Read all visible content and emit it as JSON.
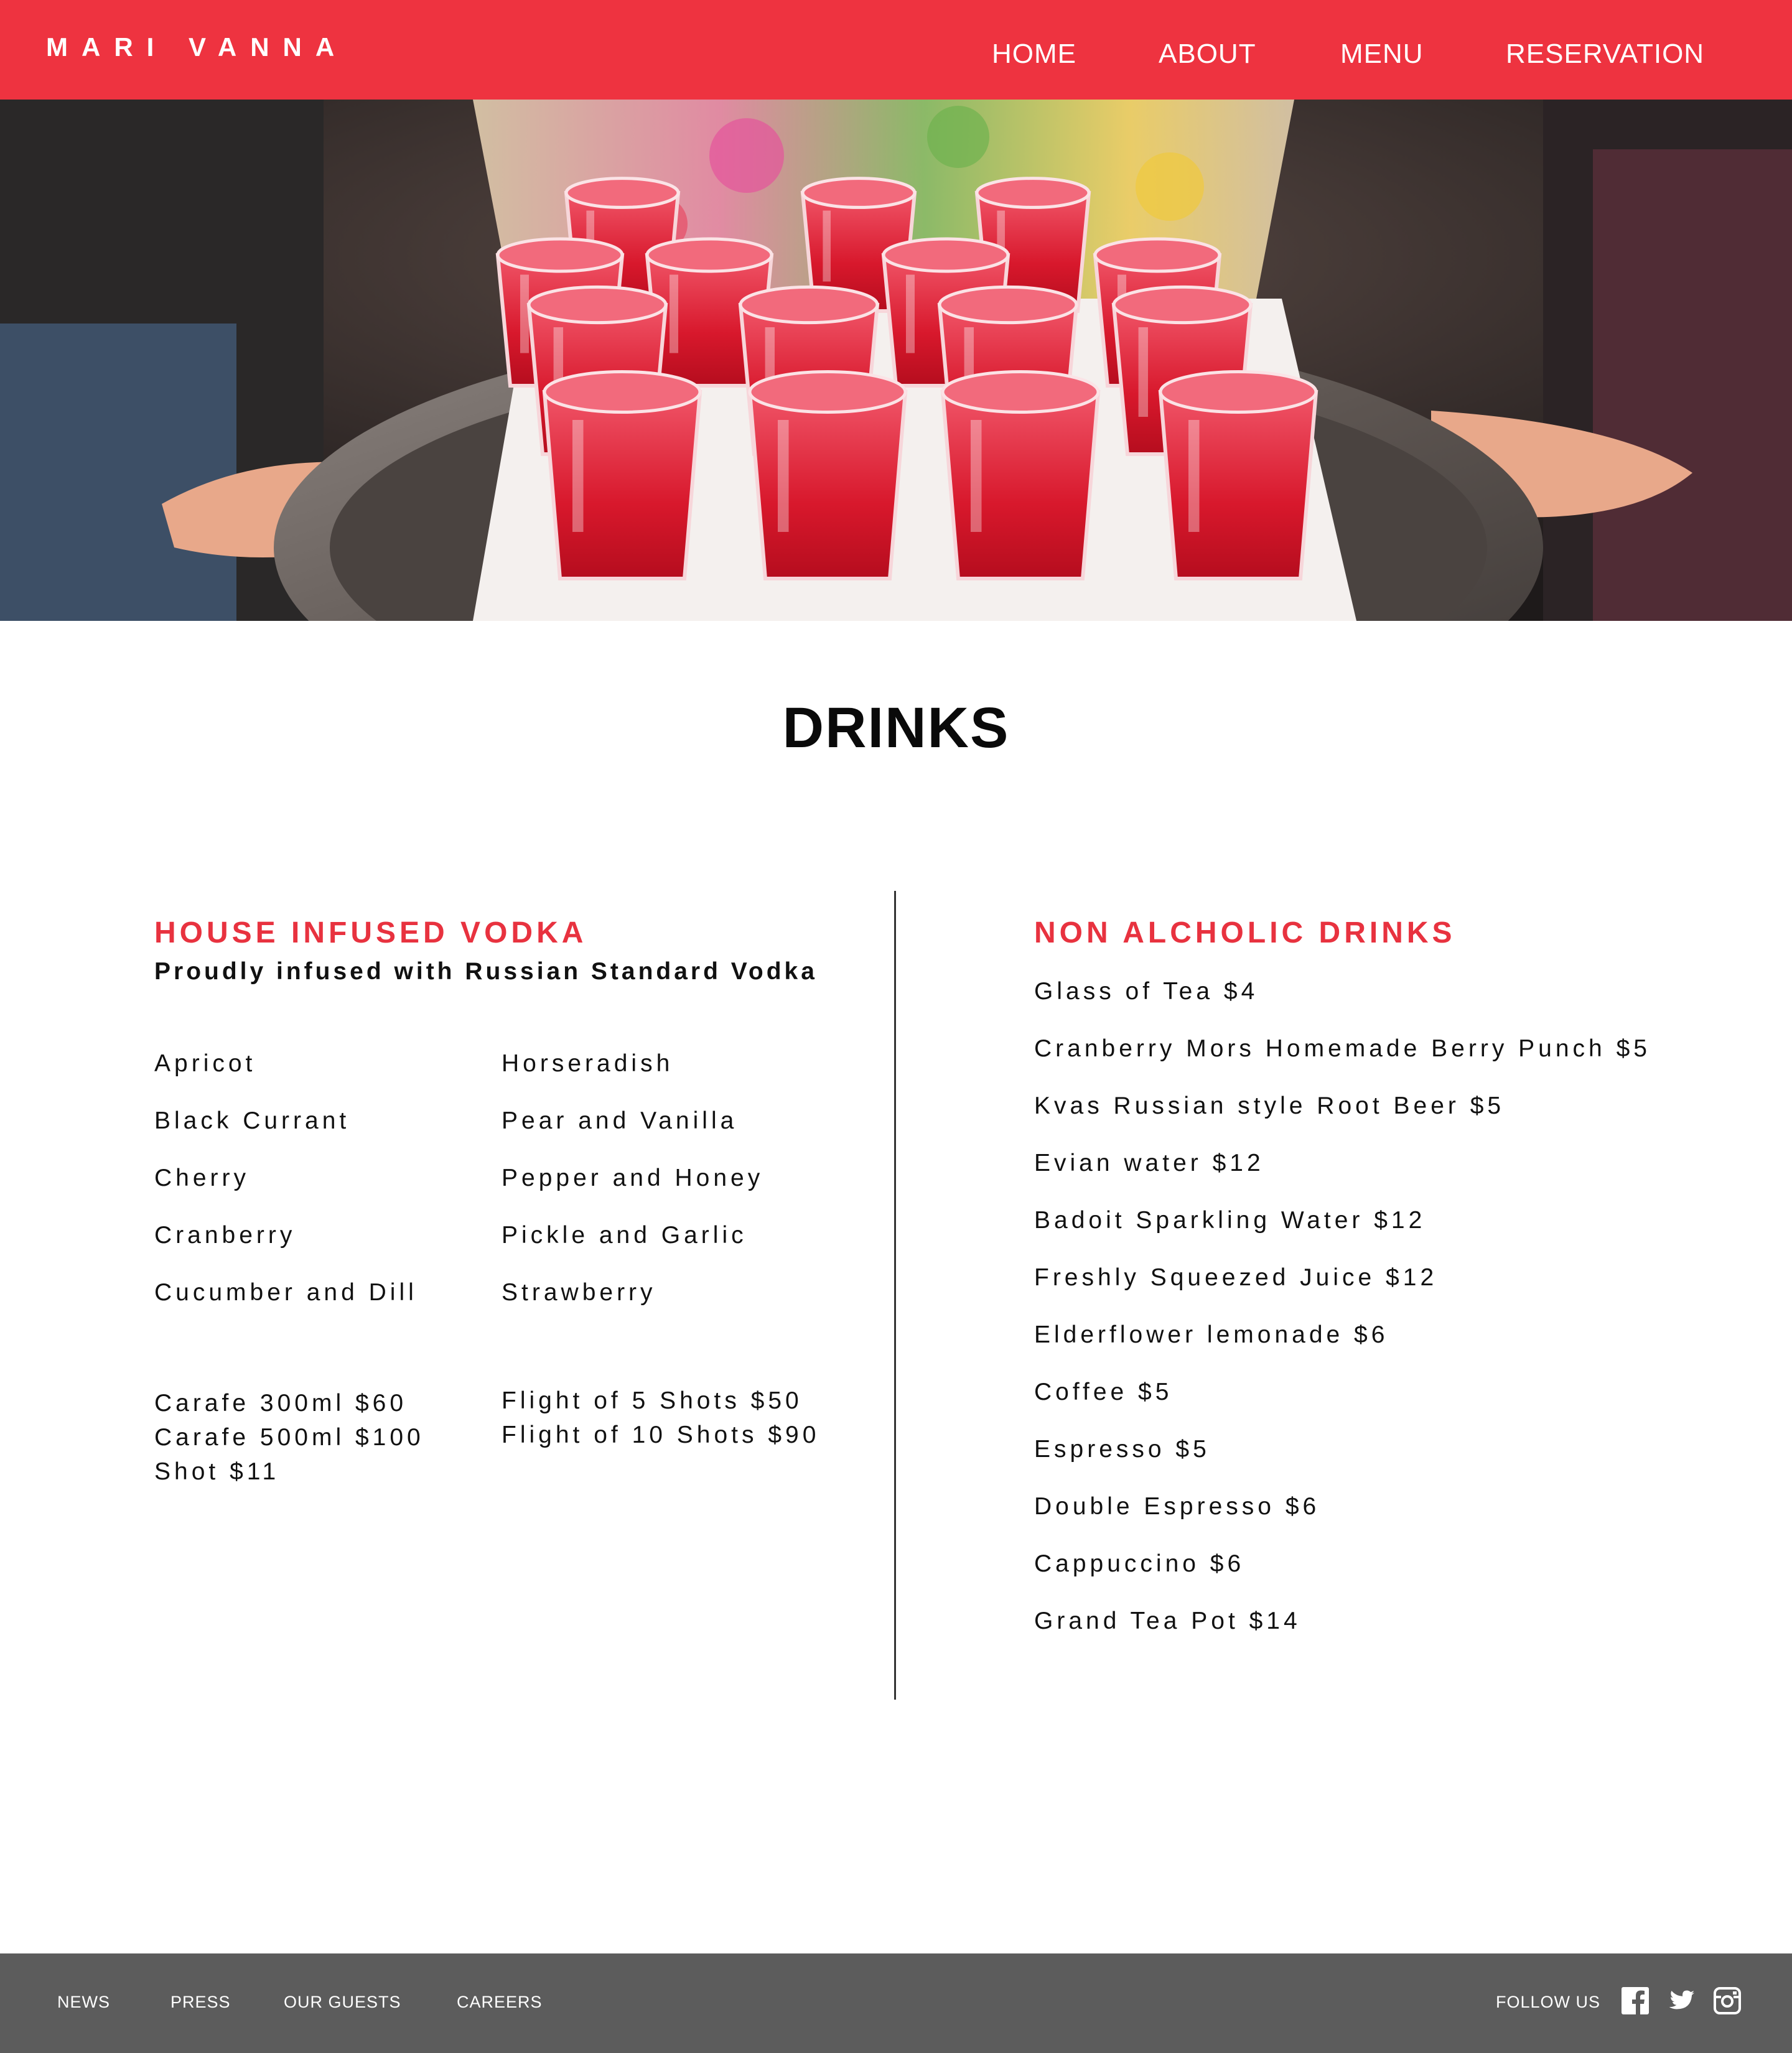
{
  "brand": {
    "logo": "MARI VANNA",
    "accent": "#ee3340",
    "heading_color": "#e8323f"
  },
  "nav": {
    "items": [
      {
        "label": "HOME"
      },
      {
        "label": "ABOUT"
      },
      {
        "label": "MENU"
      },
      {
        "label": "RESERVATION"
      }
    ]
  },
  "hero": {
    "image": "tray of red infused vodka shots"
  },
  "page": {
    "title": "DRINKS"
  },
  "vodka": {
    "heading": "HOUSE INFUSED VODKA",
    "subheading": "Proudly infused with Russian Standard Vodka",
    "flavors_left": [
      "Apricot",
      "Black Currant",
      "Cherry",
      "Cranberry",
      "Cucumber and Dill"
    ],
    "flavors_right": [
      "Horseradish",
      "Pear and Vanilla",
      "Pepper and Honey",
      "Pickle and Garlic",
      "Strawberry"
    ],
    "prices_left": [
      "Carafe 300ml $60",
      "Carafe 500ml $100",
      "Shot  $11"
    ],
    "prices_right": [
      "Flight of 5 Shots  $50",
      "Flight of 10 Shots $90"
    ]
  },
  "non_alcoholic": {
    "heading": "NON ALCHOLIC DRINKS",
    "items": [
      "Glass of Tea $4",
      "Cranberry Mors Homemade Berry Punch $5",
      "Kvas Russian style Root Beer $5",
      "Evian water $12",
      "Badoit Sparkling Water $12",
      "Freshly Squeezed Juice $12",
      "Elderflower lemonade $6",
      "Coffee $5",
      "Espresso $5",
      "Double Espresso $6",
      "Cappuccino $6",
      "Grand Tea Pot  $14"
    ]
  },
  "footer": {
    "links": [
      {
        "label": "NEWS"
      },
      {
        "label": "PRESS"
      },
      {
        "label": "OUR GUESTS"
      },
      {
        "label": "CAREERS"
      }
    ],
    "follow_label": "FOLLOW US",
    "social_icons": [
      "facebook-icon",
      "twitter-icon",
      "instagram-icon"
    ]
  }
}
